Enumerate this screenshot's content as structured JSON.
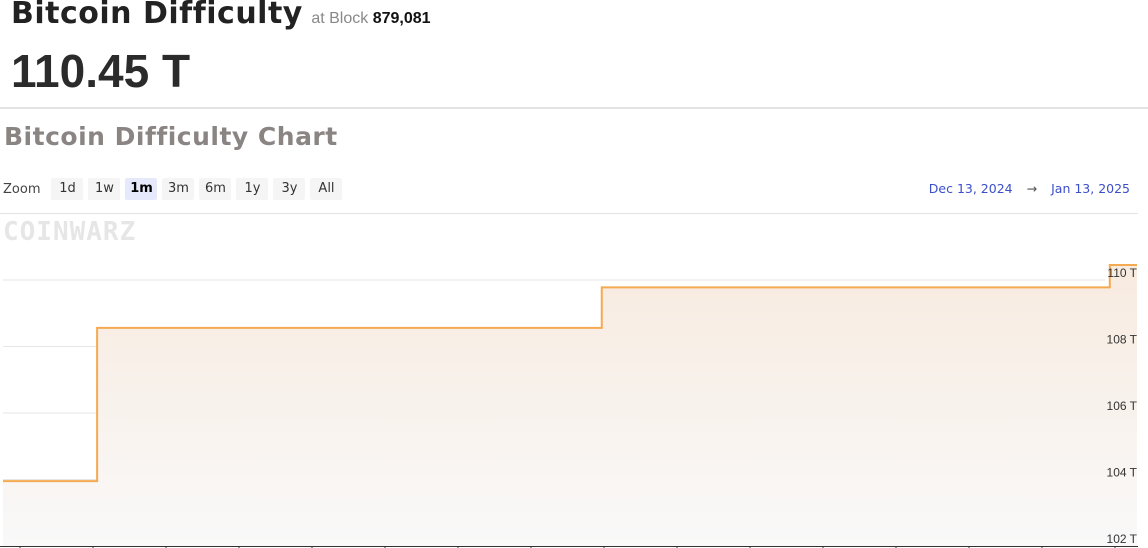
{
  "header": {
    "title": "Bitcoin Difficulty",
    "at_block_label": "at Block",
    "block_number": "879,081",
    "current_value": "110.45 T"
  },
  "chart_section": {
    "title": "Bitcoin Difficulty Chart",
    "zoom_label": "Zoom",
    "zoom_buttons": [
      {
        "label": "1d",
        "active": false
      },
      {
        "label": "1w",
        "active": false
      },
      {
        "label": "1m",
        "active": true
      },
      {
        "label": "3m",
        "active": false
      },
      {
        "label": "6m",
        "active": false
      },
      {
        "label": "1y",
        "active": false
      },
      {
        "label": "3y",
        "active": false
      },
      {
        "label": "All",
        "active": false
      }
    ],
    "range_from": "Dec 13, 2024",
    "range_arrow": "→",
    "range_to": "Jan 13, 2025",
    "watermark": "COINWARZ"
  },
  "chart_data": {
    "type": "area",
    "title": "Bitcoin Difficulty Chart",
    "xlabel": "",
    "ylabel": "",
    "x_range": [
      "Dec 13, 2024",
      "Jan 13, 2025"
    ],
    "y_unit": "T",
    "ylim": [
      102,
      111
    ],
    "y_ticks": [
      102,
      104,
      106,
      108,
      110
    ],
    "y_tick_labels": [
      "102 T",
      "104 T",
      "106 T",
      "108 T",
      "110 T"
    ],
    "grid": true,
    "line_color": "#f5a951",
    "series": [
      {
        "name": "Difficulty",
        "step": true,
        "points": [
          {
            "x_frac": 0.0,
            "value": 103.95
          },
          {
            "x_frac": 0.083,
            "value": 108.56
          },
          {
            "x_frac": 0.528,
            "value": 109.78
          },
          {
            "x_frac": 0.976,
            "value": 110.45
          },
          {
            "x_frac": 1.0,
            "value": 110.45
          }
        ]
      }
    ],
    "x_tick_count": 16
  }
}
